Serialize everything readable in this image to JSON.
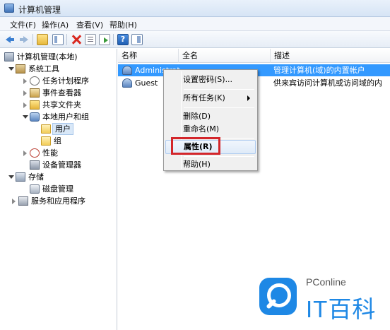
{
  "window": {
    "title": "计算机管理"
  },
  "menubar": {
    "items": [
      "文件(F)",
      "操作(A)",
      "查看(V)",
      "帮助(H)"
    ]
  },
  "toolbar": {
    "help_label": "?"
  },
  "tree": {
    "items": [
      {
        "label": "计算机管理(本地)",
        "icon": "computer-management-icon"
      },
      {
        "label": "系统工具",
        "icon": "system-tools-icon"
      },
      {
        "label": "任务计划程序",
        "icon": "task-scheduler-icon"
      },
      {
        "label": "事件查看器",
        "icon": "event-viewer-icon"
      },
      {
        "label": "共享文件夹",
        "icon": "shared-folder-icon"
      },
      {
        "label": "本地用户和组",
        "icon": "local-users-groups-icon"
      },
      {
        "label": "用户",
        "icon": "folder-icon",
        "selected": true
      },
      {
        "label": "组",
        "icon": "folder-icon"
      },
      {
        "label": "性能",
        "icon": "performance-icon"
      },
      {
        "label": "设备管理器",
        "icon": "device-manager-icon"
      },
      {
        "label": "存储",
        "icon": "storage-icon"
      },
      {
        "label": "磁盘管理",
        "icon": "disk-management-icon"
      },
      {
        "label": "服务和应用程序",
        "icon": "services-apps-icon"
      }
    ]
  },
  "list": {
    "columns": [
      "名称",
      "全名",
      "描述"
    ],
    "rows": [
      {
        "name": "Administrat",
        "full_name": "",
        "description": "管理计算机(域)的内置帐户",
        "selected": true
      },
      {
        "name": "Guest",
        "full_name": "",
        "description": "供来宾访问计算机或访问域的内"
      }
    ]
  },
  "context_menu": {
    "items": [
      "设置密码(S)...",
      "所有任务(K)",
      "删除(D)",
      "重命名(M)",
      "属性(R)",
      "帮助(H)"
    ],
    "highlighted": "属性(R)"
  },
  "watermark": {
    "brand": "PConline",
    "name": "IT百科"
  },
  "colors": {
    "selection": "#3399ff",
    "highlight_box": "#d3262b",
    "watermark_blue": "#1e88e5"
  }
}
